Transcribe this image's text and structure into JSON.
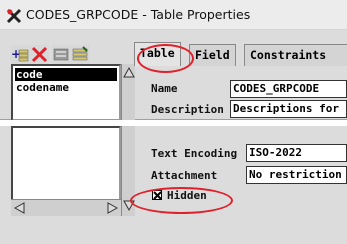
{
  "window": {
    "title": "CODES_GRPCODE - Table Properties"
  },
  "toolbar": {
    "buttons": [
      "add-field-icon",
      "delete-field-icon",
      "move-field-icon",
      "edit-field-icon"
    ]
  },
  "field_list": {
    "items": [
      {
        "label": "code",
        "selected": true
      },
      {
        "label": "codename",
        "selected": false
      }
    ]
  },
  "tabs": [
    {
      "label": "Table",
      "active": true
    },
    {
      "label": "Field",
      "active": false
    },
    {
      "label": "Constraints",
      "active": false
    }
  ],
  "table_tab": {
    "name_label": "Name",
    "name_value": "CODES_GRPCODE",
    "description_label": "Description",
    "description_value": "Descriptions for",
    "text_encoding_label": "Text Encoding",
    "text_encoding_value": "ISO-2022",
    "attachment_label": "Attachment",
    "attachment_value": "No restriction",
    "hidden_label": "Hidden",
    "hidden_checked": true
  },
  "highlight_color": "#e0202a"
}
